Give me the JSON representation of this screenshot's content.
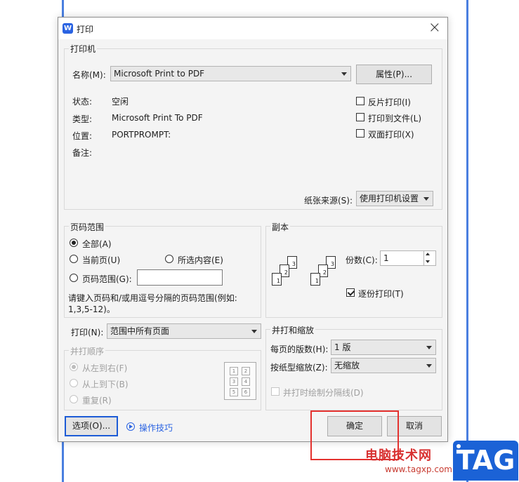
{
  "window": {
    "title": "打印",
    "app_icon_letter": "W",
    "close": "×"
  },
  "printer": {
    "legend": "打印机",
    "name_label": "名称(M):",
    "name_value": "Microsoft Print to PDF",
    "properties_button": "属性(P)...",
    "status_label": "状态:",
    "status_value": "空闲",
    "type_label": "类型:",
    "type_value": "Microsoft Print To PDF",
    "location_label": "位置:",
    "location_value": "PORTPROMPT:",
    "comment_label": "备注:",
    "reverse_print": "反片打印(I)",
    "print_to_file": "打印到文件(L)",
    "duplex_print": "双面打印(X)",
    "paper_source_label": "纸张来源(S):",
    "paper_source_value": "使用打印机设置"
  },
  "page_range": {
    "legend": "页码范围",
    "all": "全部(A)",
    "current_page": "当前页(U)",
    "selection": "所选内容(E)",
    "pages": "页码范围(G):",
    "pages_value": "",
    "hint": "请键入页码和/或用逗号分隔的页码范围(例如:",
    "hint_example": "1,3,5-12)。"
  },
  "print_what": {
    "label": "打印(N):",
    "value": "范围中所有页面"
  },
  "collate_order": {
    "legend": "并打顺序",
    "left_to_right": "从左到右(F)",
    "top_to_bottom": "从上到下(B)",
    "repeat": "重复(R)",
    "grid_numbers": [
      "1",
      "2",
      "3",
      "4",
      "5",
      "6"
    ]
  },
  "copies": {
    "legend": "副本",
    "count_label": "份数(C):",
    "count_value": "1",
    "collate": "逐份打印(T)",
    "stack_a": [
      "1",
      "2",
      "3"
    ],
    "stack_b": [
      "1",
      "2",
      "3"
    ]
  },
  "zoom": {
    "legend": "并打和缩放",
    "pages_per_sheet_label": "每页的版数(H):",
    "pages_per_sheet_value": "1 版",
    "scale_label": "按纸型缩放(Z):",
    "scale_value": "无缩放",
    "draw_borders": "并打时绘制分隔线(D)"
  },
  "footer": {
    "options_button": "选项(O)...",
    "tips_link": "操作技巧",
    "ok_button": "确定",
    "cancel_button": "取消"
  },
  "watermark": {
    "site_name": "电脑技术网",
    "url": "www.tagxp.com",
    "badge": "TAG"
  },
  "colors": {
    "accent": "#2a63e2",
    "highlight": "#e4322f",
    "badge_blue": "#1b62d6"
  }
}
